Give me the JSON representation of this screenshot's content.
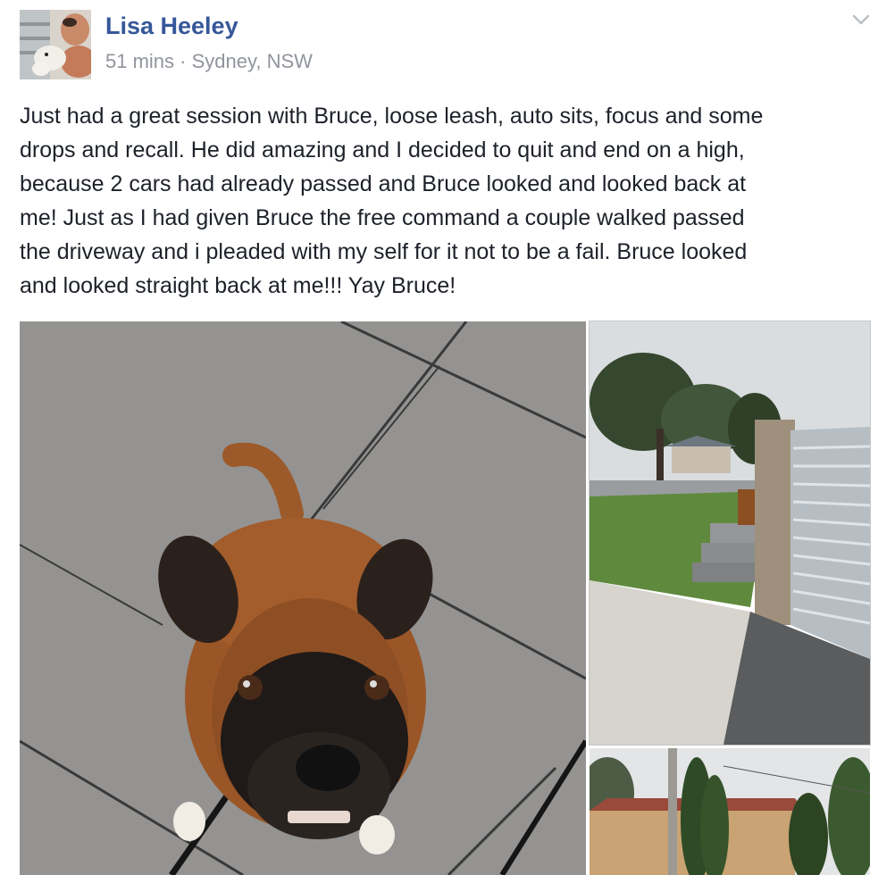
{
  "post": {
    "author": "Lisa Heeley",
    "time": "51 mins",
    "separator": "·",
    "location": "Sydney, NSW",
    "text": "Just had a great session with Bruce, loose leash, auto sits, focus and some\ndrops and recall. He did amazing and I decided to quit and end on a high,\nbecause 2 cars had already passed and Bruce looked and looked back at\nme! Just as I had given Bruce the free command a couple walked passed\nthe driveway and i pleaded with my self for it not to be a fail. Bruce looked\nand looked straight back at me!!! Yay Bruce!"
  },
  "icons": {
    "options": "chevron-down-icon"
  },
  "colors": {
    "author_link": "#365899",
    "meta_text": "#90949c",
    "body_text": "#1d2129"
  }
}
